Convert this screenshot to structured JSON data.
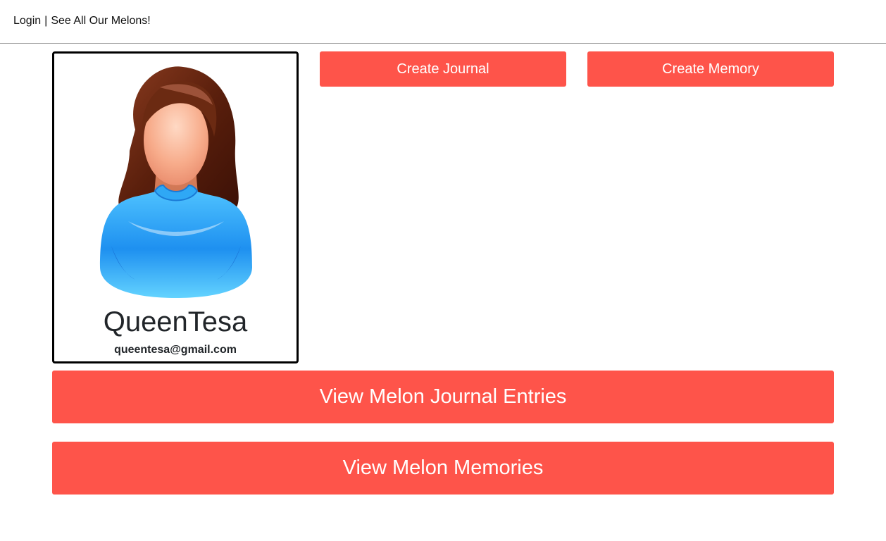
{
  "nav": {
    "login_label": "Login",
    "separator": "|",
    "melons_label": "See All Our Melons!"
  },
  "profile": {
    "avatar_icon": "woman-avatar-icon",
    "username": "QueenTesa",
    "email": "queentesa@gmail.com"
  },
  "actions": {
    "create_journal_label": "Create Journal",
    "create_memory_label": "Create Memory",
    "view_journal_entries_label": "View Melon Journal Entries",
    "view_memories_label": "View Melon Memories"
  },
  "colors": {
    "button_accent": "#fe544a",
    "card_border": "#000000"
  }
}
